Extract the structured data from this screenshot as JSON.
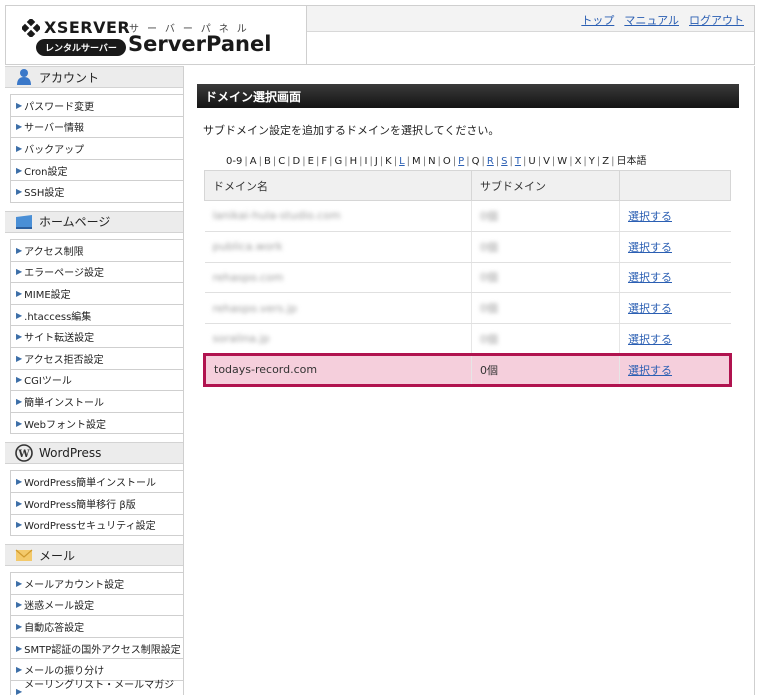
{
  "header": {
    "brand": "XSERVER",
    "badge": "レンタルサーバー",
    "kana": "サーバーパネル",
    "title": "ServerPanel",
    "links": [
      "トップ",
      "マニュアル",
      "ログアウト"
    ]
  },
  "sidebar": {
    "sections": [
      {
        "title": "アカウント",
        "icon": "user-icon",
        "items": [
          "パスワード変更",
          "サーバー情報",
          "バックアップ",
          "Cron設定",
          "SSH設定"
        ]
      },
      {
        "title": "ホームページ",
        "icon": "monitor-icon",
        "items": [
          "アクセス制限",
          "エラーページ設定",
          "MIME設定",
          ".htaccess編集",
          "サイト転送設定",
          "アクセス拒否設定",
          "CGIツール",
          "簡単インストール",
          "Webフォント設定"
        ]
      },
      {
        "title": "WordPress",
        "icon": "wordpress-icon",
        "items": [
          "WordPress簡単インストール",
          "WordPress簡単移行 β版",
          "WordPressセキュリティ設定"
        ]
      },
      {
        "title": "メール",
        "icon": "envelope-icon",
        "items": [
          "メールアカウント設定",
          "迷惑メール設定",
          "自動応答設定",
          "SMTP認証の国外アクセス制限設定",
          "メールの振り分け",
          "メーリングリスト・メールマガジン"
        ]
      }
    ]
  },
  "main": {
    "title": "ドメイン選択画面",
    "description": "サブドメイン設定を追加するドメインを選択してください。",
    "alphabet": [
      {
        "t": "0-9",
        "link": false
      },
      {
        "t": "A",
        "link": false
      },
      {
        "t": "B",
        "link": false
      },
      {
        "t": "C",
        "link": false
      },
      {
        "t": "D",
        "link": false
      },
      {
        "t": "E",
        "link": false
      },
      {
        "t": "F",
        "link": false
      },
      {
        "t": "G",
        "link": false
      },
      {
        "t": "H",
        "link": false
      },
      {
        "t": "I",
        "link": false
      },
      {
        "t": "J",
        "link": false
      },
      {
        "t": "K",
        "link": false
      },
      {
        "t": "L",
        "link": true
      },
      {
        "t": "M",
        "link": false
      },
      {
        "t": "N",
        "link": false
      },
      {
        "t": "O",
        "link": false
      },
      {
        "t": "P",
        "link": true
      },
      {
        "t": "Q",
        "link": false
      },
      {
        "t": "R",
        "link": true
      },
      {
        "t": "S",
        "link": true
      },
      {
        "t": "T",
        "link": true
      },
      {
        "t": "U",
        "link": false
      },
      {
        "t": "V",
        "link": false
      },
      {
        "t": "W",
        "link": false
      },
      {
        "t": "X",
        "link": false
      },
      {
        "t": "Y",
        "link": false
      },
      {
        "t": "Z",
        "link": false
      },
      {
        "t": "日本語",
        "link": false
      }
    ],
    "table": {
      "headers": [
        "ドメイン名",
        "サブドメイン",
        ""
      ],
      "rows": [
        {
          "domain": "lanikai-hula-studio.com",
          "sub": "0個",
          "action": "選択する",
          "blurred": true
        },
        {
          "domain": "publica.work",
          "sub": "0個",
          "action": "選択する",
          "blurred": true
        },
        {
          "domain": "rehaspo.com",
          "sub": "0個",
          "action": "選択する",
          "blurred": true
        },
        {
          "domain": "rehaspo.vers.jp",
          "sub": "0個",
          "action": "選択する",
          "blurred": true
        },
        {
          "domain": "soralina.jp",
          "sub": "0個",
          "action": "選択する",
          "blurred": true
        },
        {
          "domain": "todays-record.com",
          "sub": "0個",
          "action": "選択する",
          "blurred": false,
          "highlight": true
        }
      ]
    }
  },
  "colors": {
    "link": "#2b5fb3",
    "highlight_bg": "#f5cfdc",
    "highlight_border": "#b0134f",
    "title_bar": "#1e1e1e"
  }
}
